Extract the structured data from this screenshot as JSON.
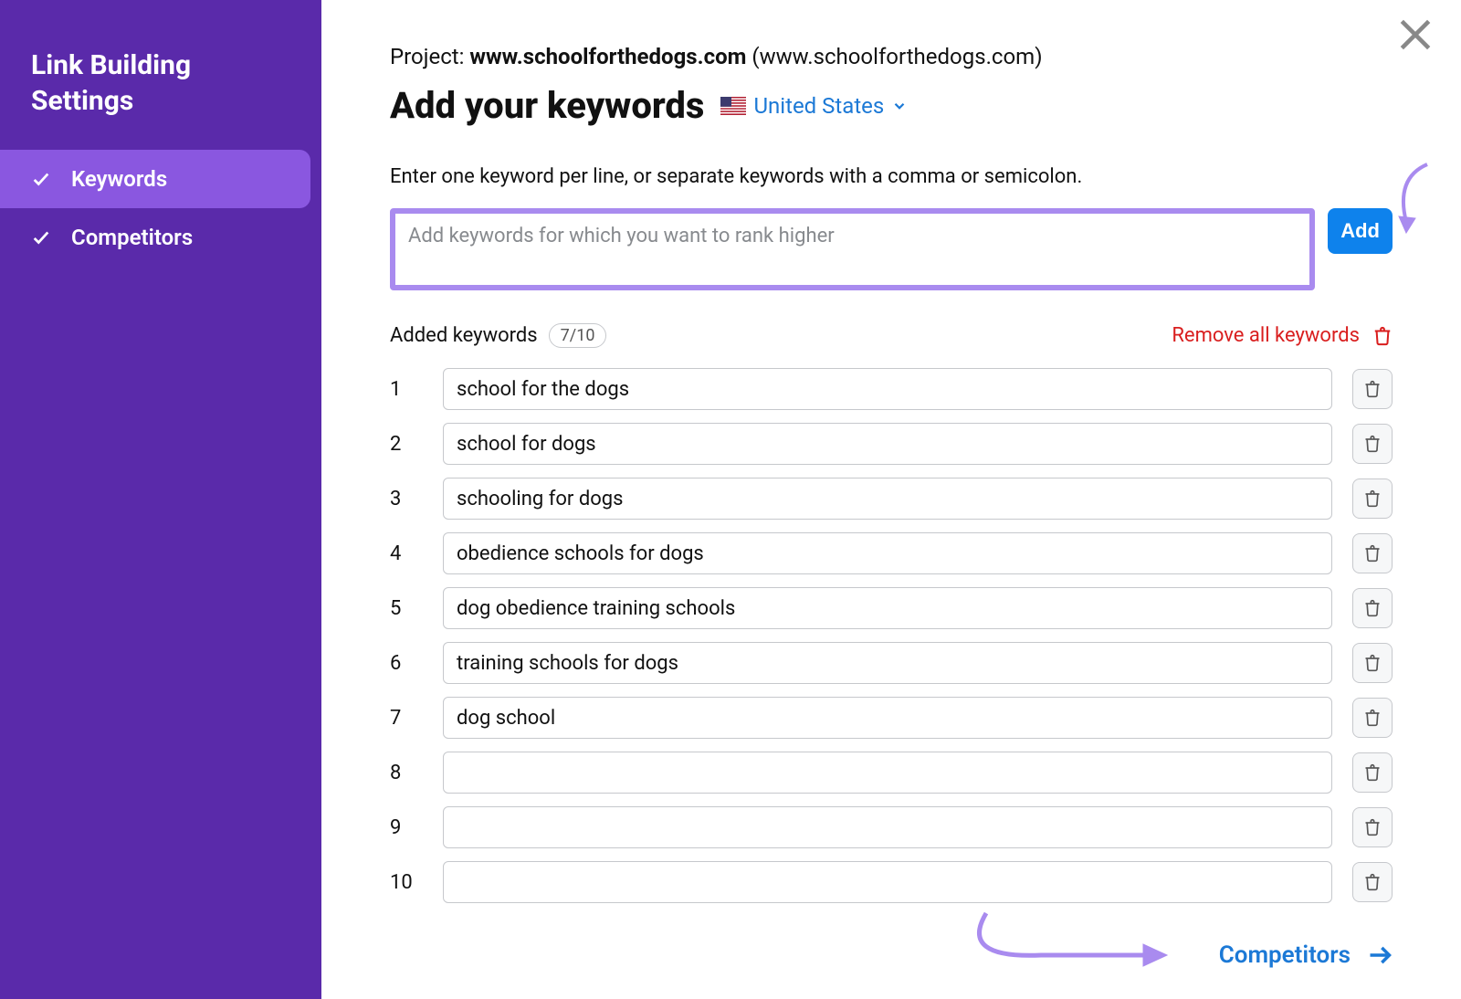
{
  "sidebar": {
    "title": "Link Building Settings",
    "items": [
      {
        "label": "Keywords",
        "active": true
      },
      {
        "label": "Competitors",
        "active": false
      }
    ]
  },
  "project": {
    "prefix": "Project:",
    "domain": "www.schoolforthedogs.com",
    "paren": "(www.schoolforthedogs.com)"
  },
  "page_title": "Add your keywords",
  "location": {
    "label": "United States",
    "flag": "🇺🇸"
  },
  "instructions": "Enter one keyword per line, or separate keywords with a comma or semicolon.",
  "input": {
    "placeholder": "Add keywords for which you want to rank higher",
    "add_label": "Add"
  },
  "added": {
    "label": "Added keywords",
    "count": "7/10",
    "remove_all_label": "Remove all keywords",
    "rows": [
      {
        "num": "1",
        "value": "school for the dogs"
      },
      {
        "num": "2",
        "value": "school for dogs"
      },
      {
        "num": "3",
        "value": "schooling for dogs"
      },
      {
        "num": "4",
        "value": "obedience schools for dogs"
      },
      {
        "num": "5",
        "value": "dog obedience training schools"
      },
      {
        "num": "6",
        "value": "training schools for dogs"
      },
      {
        "num": "7",
        "value": "dog school"
      },
      {
        "num": "8",
        "value": ""
      },
      {
        "num": "9",
        "value": ""
      },
      {
        "num": "10",
        "value": ""
      }
    ]
  },
  "next_link": {
    "label": "Competitors"
  }
}
